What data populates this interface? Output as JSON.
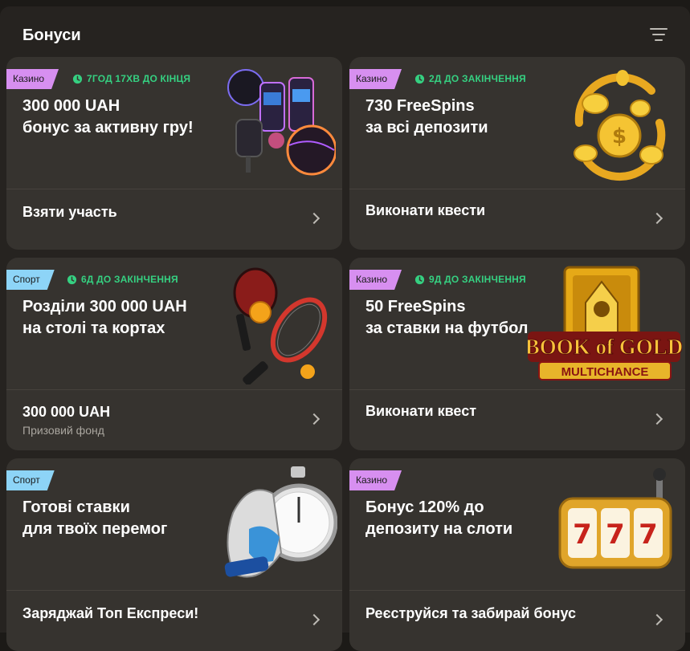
{
  "header": {
    "title": "Бонуси"
  },
  "colors": {
    "casino_tag": "#d78ff0",
    "sport_tag": "#8dd4f7",
    "timer": "#35d081",
    "card_bg": "#36332f"
  },
  "cards": [
    {
      "tag": "Казино",
      "timer": "7ГОД 17ХВ ДО КІНЦЯ",
      "title_line1": "300 000 UAH",
      "title_line2": "бонус за активну гру!",
      "action": "Взяти участь",
      "art": "slot-machines-art"
    },
    {
      "tag": "Казино",
      "timer": "2Д ДО ЗАКІНЧЕННЯ",
      "title_line1": "730 FreeSpins",
      "title_line2": "за всі депозити",
      "action": "Виконати квести",
      "art": "gold-coins-art"
    },
    {
      "tag": "Спорт",
      "timer": "6Д ДО ЗАКІНЧЕННЯ",
      "title_line1": "Розділи 300 000 UAH",
      "title_line2": "на столі та кортах",
      "prize_value": "300 000 UAH",
      "prize_label": "Призовий фонд",
      "art": "rackets-art"
    },
    {
      "tag": "Казино",
      "timer": "9Д ДО ЗАКІНЧЕННЯ",
      "title_line1": "50 FreeSpins",
      "title_line2": "за ставки на футбол",
      "action": "Виконати квест",
      "art": "book-of-gold-art",
      "logo_text_1": "BOOK of GOLD",
      "logo_text_2": "MULTICHANCE"
    },
    {
      "tag": "Спорт",
      "title_line1": "Готові ставки",
      "title_line2": "для твоїх перемог",
      "action": "Заряджай Топ Експреси!",
      "art": "stopwatch-glove-art"
    },
    {
      "tag": "Казино",
      "title_line1": "Бонус 120% до",
      "title_line2": "депозиту на слоти",
      "action": "Реєструйся та забирай бонус",
      "art": "slot-777-art"
    }
  ]
}
